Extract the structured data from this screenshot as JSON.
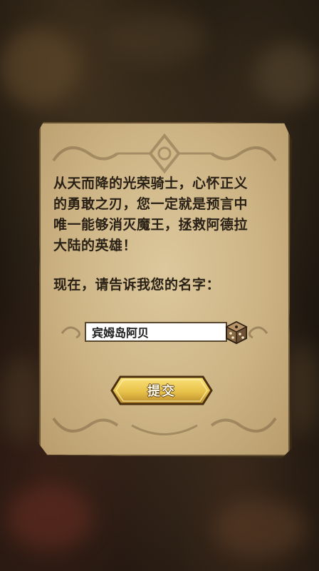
{
  "dialog": {
    "story_lines": [
      "从天而降的光荣骑士，心怀正义",
      "的勇敢之刃，您一定就是预言中",
      "唯一能够消灭魔王，拯救阿德拉",
      "大陆的英雄！"
    ],
    "prompt": "现在，请告诉我您的名字：",
    "name_input": {
      "value": "宾姆岛阿贝",
      "placeholder": ""
    },
    "random_name_icon": "dice-icon",
    "submit_label": "提交"
  },
  "colors": {
    "parchment": "#cdb485",
    "text": "#2a2116",
    "button_gold": "#e8c24a",
    "background": "#1c150e"
  }
}
